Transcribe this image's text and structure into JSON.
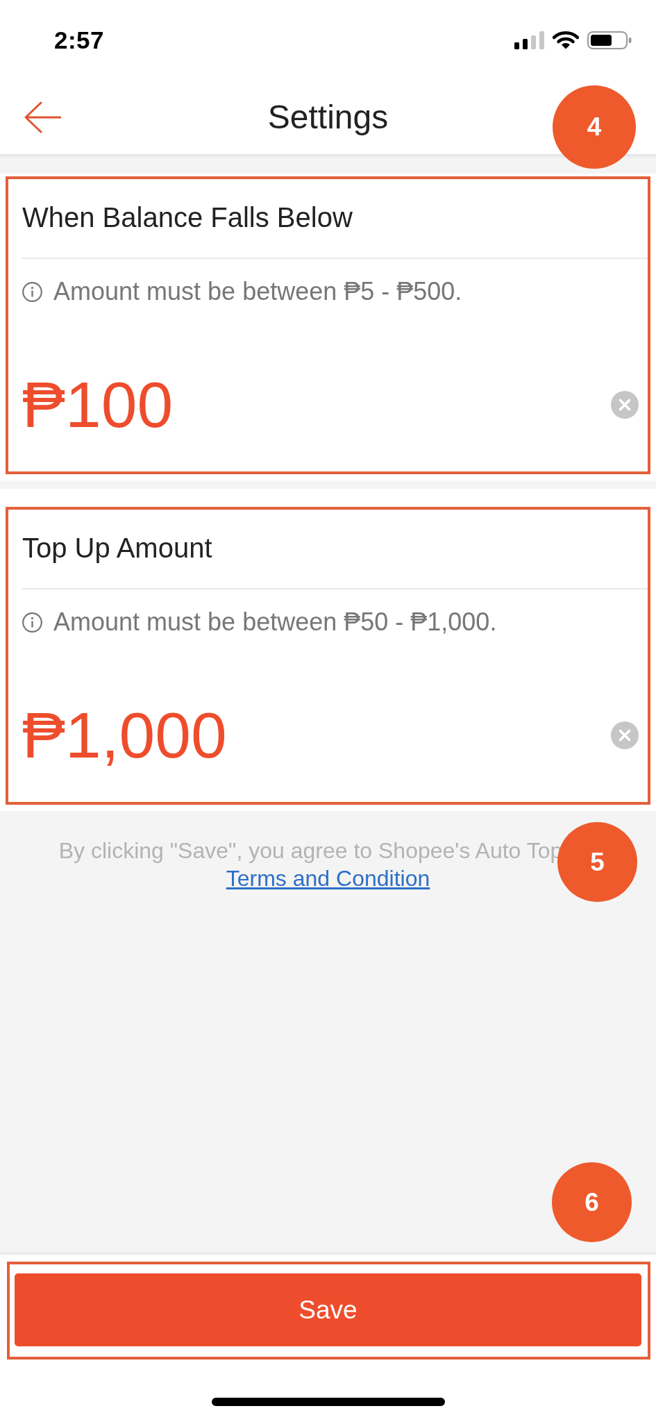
{
  "status_bar": {
    "time": "2:57"
  },
  "header": {
    "title": "Settings",
    "callout": "4"
  },
  "sections": [
    {
      "title": "When Balance Falls Below",
      "hint": "Amount must be between ₱5 - ₱500.",
      "value": "₱100",
      "highlighted": true
    },
    {
      "title": "Top Up Amount",
      "hint": "Amount must be between ₱50 - ₱1,000.",
      "value": "₱1,000",
      "highlighted": true
    }
  ],
  "terms": {
    "text": "By clicking \"Save\", you agree to Shopee's Auto Top",
    "link": "Terms and Condition",
    "callout": "5"
  },
  "save_bar": {
    "button": "Save",
    "highlighted": true,
    "callout": "6"
  }
}
